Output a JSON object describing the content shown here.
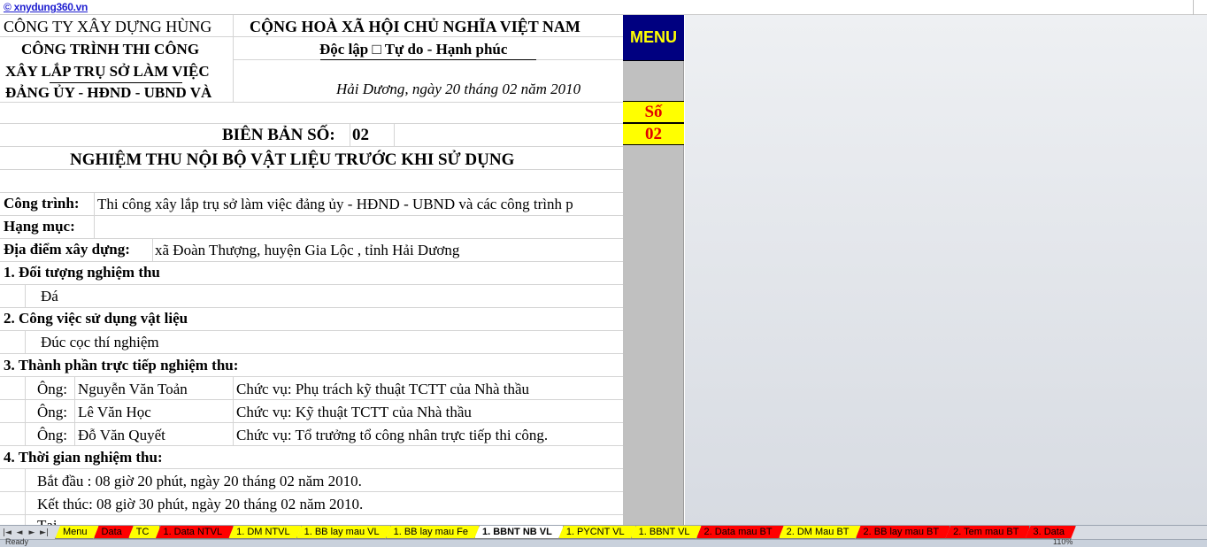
{
  "top_link": {
    "text": "© xnydung360.vn"
  },
  "header": {
    "company_line1": "CÔNG TY XÂY DỰNG HÙNG",
    "company_line2": "CÔNG TRÌNH THI CÔNG",
    "company_line3": "XÂY LẮP TRỤ SỞ LÀM VIỆC",
    "company_line4": "ĐẢNG ỦY - HĐND - UBND VÀ",
    "nation": "CỘNG HOÀ XÃ HỘI CHỦ NGHĨA VIỆT NAM",
    "motto": "Độc lập □ Tự do - Hạnh phúc",
    "place_date": "Hải Dương, ngày 20 tháng 02 năm 2010"
  },
  "record": {
    "label": "BIÊN BẢN SỐ:",
    "number": "02",
    "title": "NGHIỆM THU NỘI BỘ VẬT LIỆU TRƯỚC KHI SỬ DỤNG"
  },
  "project": {
    "label": "Công trình:",
    "value": "Thi công xây lắp trụ sở làm việc đảng ủy - HĐND - UBND và các công trình p",
    "item_label": "Hạng mục:",
    "location_label": "Địa điểm xây dựng:",
    "location_value": "xã Đoàn Thượng, huyện Gia Lộc , tỉnh Hải Dương"
  },
  "sections": {
    "s1_title": "1. Đối tượng nghiệm thu",
    "s1_value": "Đá",
    "s2_title": "2. Công việc sử dụng vật liệu",
    "s2_value": "Đúc cọc thí nghiệm",
    "s3_title": "3. Thành phần trực tiếp nghiệm thu:",
    "s4_title": "4. Thời gian nghiệm thu:",
    "start": "Bắt đầu : 08 giờ 20 phút, ngày 20 tháng 02 năm 2010.",
    "end": "Kết thúc: 08 giờ 30 phút, ngày 20 tháng 02 năm 2010.",
    "cut_row": "Tại"
  },
  "members": [
    {
      "title": "Ông:",
      "name": "Nguyễn Văn Toản",
      "role": "Chức vụ: Phụ trách kỹ thuật TCTT của Nhà thầu"
    },
    {
      "title": "Ông:",
      "name": "Lê Văn Học",
      "role": "Chức vụ: Kỹ thuật TCTT của Nhà thầu"
    },
    {
      "title": "Ông:",
      "name": "Đỗ Văn Quyết",
      "role": "Chức vụ: Tổ trưởng tổ công nhân trực tiếp thi công."
    }
  ],
  "side_panel": {
    "menu_label": "MENU",
    "so_label": "Số",
    "so_value": "02"
  },
  "nav_icons": [
    "first-sheet-icon",
    "prev-sheet-icon",
    "next-sheet-icon",
    "last-sheet-icon"
  ],
  "nav_glyphs": [
    "|◄",
    "◄",
    "►",
    "►|"
  ],
  "tabs": [
    {
      "label": "Menu",
      "color": "#ffff00"
    },
    {
      "label": "Data",
      "color": "#ff0000"
    },
    {
      "label": "TC",
      "color": "#ffff00"
    },
    {
      "label": "1. Data NTVL",
      "color": "#ff0000"
    },
    {
      "label": "1. DM NTVL",
      "color": "#ffff00"
    },
    {
      "label": "1. BB lay mau VL",
      "color": "#ffff00"
    },
    {
      "label": "1. BB lay mau Fe",
      "color": "#ffff00"
    },
    {
      "label": "1. BBNT NB VL",
      "color": "#ffffff",
      "active": true
    },
    {
      "label": "1. PYCNT VL",
      "color": "#ffff00"
    },
    {
      "label": "1. BBNT VL",
      "color": "#ffff00"
    },
    {
      "label": "2. Data mau BT",
      "color": "#ff0000"
    },
    {
      "label": "2. DM Mau BT",
      "color": "#ffff00"
    },
    {
      "label": "2. BB lay mau BT",
      "color": "#ff0000"
    },
    {
      "label": "2. Tem mau BT",
      "color": "#ff0000"
    },
    {
      "label": "3. Data",
      "color": "#ff0000"
    }
  ],
  "status": {
    "ready": "Ready",
    "zoom": "110%"
  }
}
